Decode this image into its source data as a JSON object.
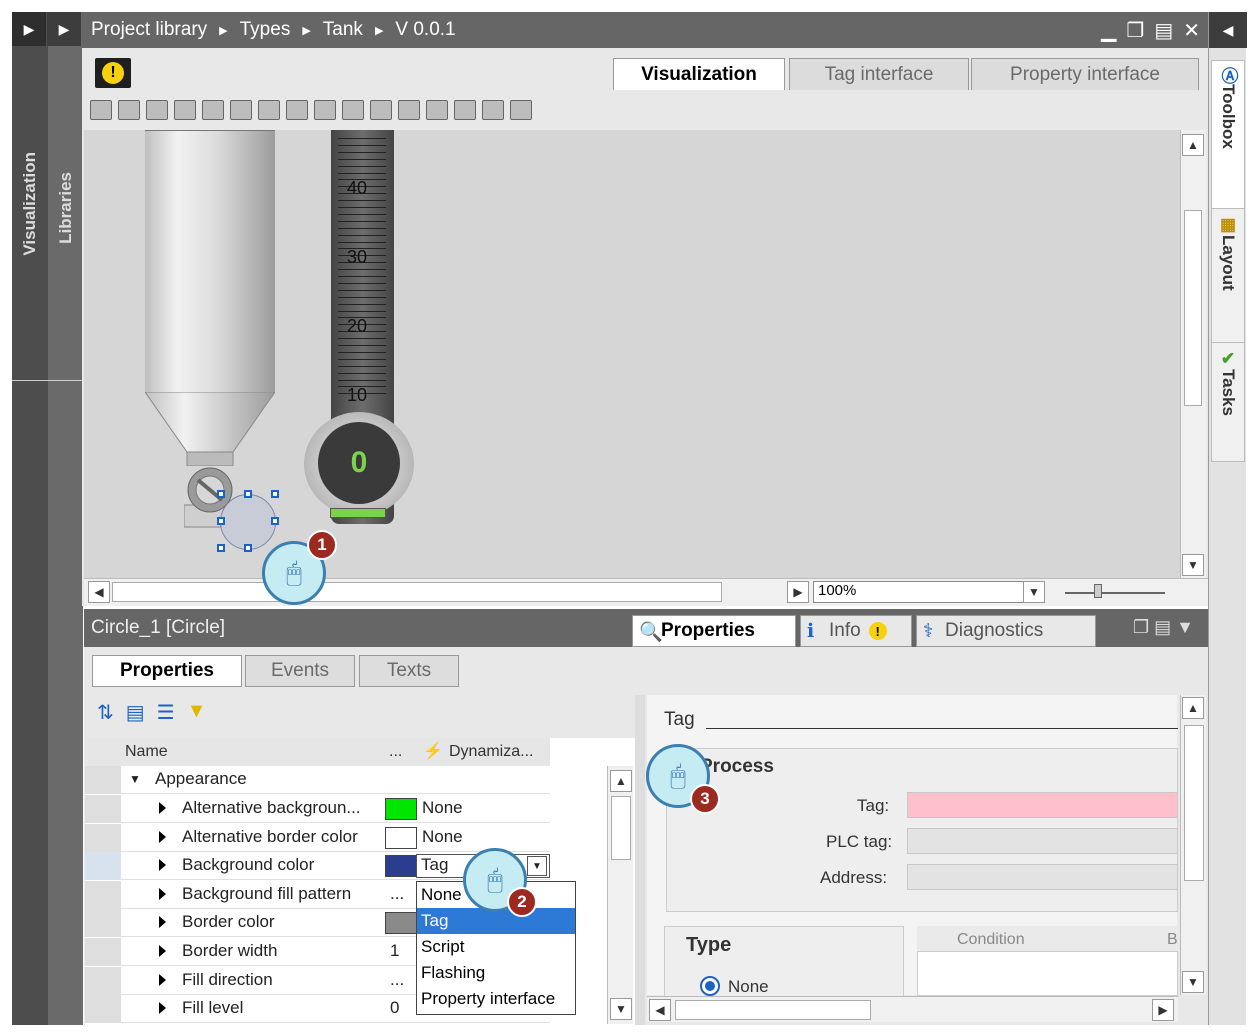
{
  "title_bar": {
    "breadcrumb": [
      "Project library",
      "Types",
      "Tank",
      "V 0.0.1"
    ]
  },
  "left_panels": {
    "visualization": "Visualization",
    "libraries": "Libraries"
  },
  "right_panels": {
    "toolbox": "Toolbox",
    "layout": "Layout",
    "tasks": "Tasks"
  },
  "editor_tabs": {
    "visualization": "Visualization",
    "tag_interface": "Tag interface",
    "property_interface": "Property interface"
  },
  "gauge": {
    "value": "0",
    "scale_labels": [
      "40",
      "30",
      "20",
      "10"
    ]
  },
  "zoom": "100%",
  "selected_object": "Circle_1 [Circle]",
  "inspector_tabs": {
    "properties": "Properties",
    "info": "Info",
    "diagnostics": "Diagnostics"
  },
  "property_tabs": {
    "properties": "Properties",
    "events": "Events",
    "texts": "Texts"
  },
  "table": {
    "col_name": "Name",
    "col_dots": "...",
    "col_dyn": "Dynamiza...",
    "group": "Appearance",
    "rows": [
      {
        "name": "Alternative backgroun...",
        "dyn": "None",
        "color": "#00e600"
      },
      {
        "name": "Alternative border color",
        "dyn": "None",
        "color": "#ffffff"
      },
      {
        "name": "Background color",
        "dyn": "Tag",
        "color": "#2a3d8f"
      },
      {
        "name": "Background fill pattern",
        "val": "...",
        "dyn": ""
      },
      {
        "name": "Border color",
        "color": "#8a8a8a",
        "dyn": ""
      },
      {
        "name": "Border width",
        "val": "1",
        "dyn": ""
      },
      {
        "name": "Fill direction",
        "val": "...",
        "dyn": ""
      },
      {
        "name": "Fill level",
        "val": "0",
        "dyn": ""
      }
    ]
  },
  "dropdown_options": [
    "None",
    "Tag",
    "Script",
    "Flashing",
    "Property interface"
  ],
  "dropdown_selected": "Tag",
  "tag_panel": {
    "heading": "Tag",
    "process": "Process",
    "tag_label": "Tag:",
    "plc_tag_label": "PLC tag:",
    "address_label": "Address:",
    "type_heading": "Type",
    "type_none": "None",
    "condition_col": "Condition",
    "col_b": "B"
  },
  "callouts": [
    "1",
    "2",
    "3"
  ]
}
